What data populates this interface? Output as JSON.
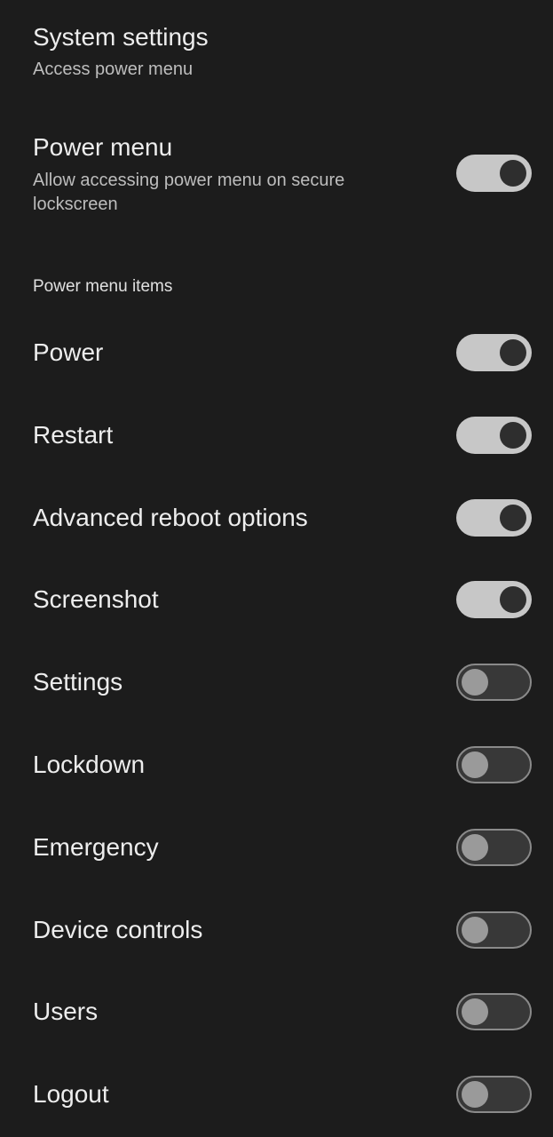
{
  "header": {
    "title": "System settings",
    "subtitle": "Access power menu"
  },
  "power_menu_setting": {
    "title": "Power menu",
    "description": "Allow accessing power menu on secure lockscreen",
    "enabled": true
  },
  "section": {
    "title": "Power menu items"
  },
  "items": [
    {
      "label": "Power",
      "enabled": true
    },
    {
      "label": "Restart",
      "enabled": true
    },
    {
      "label": "Advanced reboot options",
      "enabled": true
    },
    {
      "label": "Screenshot",
      "enabled": true
    },
    {
      "label": "Settings",
      "enabled": false
    },
    {
      "label": "Lockdown",
      "enabled": false
    },
    {
      "label": "Emergency",
      "enabled": false
    },
    {
      "label": "Device controls",
      "enabled": false
    },
    {
      "label": "Users",
      "enabled": false
    },
    {
      "label": "Logout",
      "enabled": false
    }
  ],
  "colors": {
    "background": "#1c1c1c",
    "switch_on_track": "#c7c7c7",
    "switch_on_thumb": "#2e2e2e",
    "switch_off_track": "#383838",
    "switch_off_thumb": "#9a9a9a"
  }
}
